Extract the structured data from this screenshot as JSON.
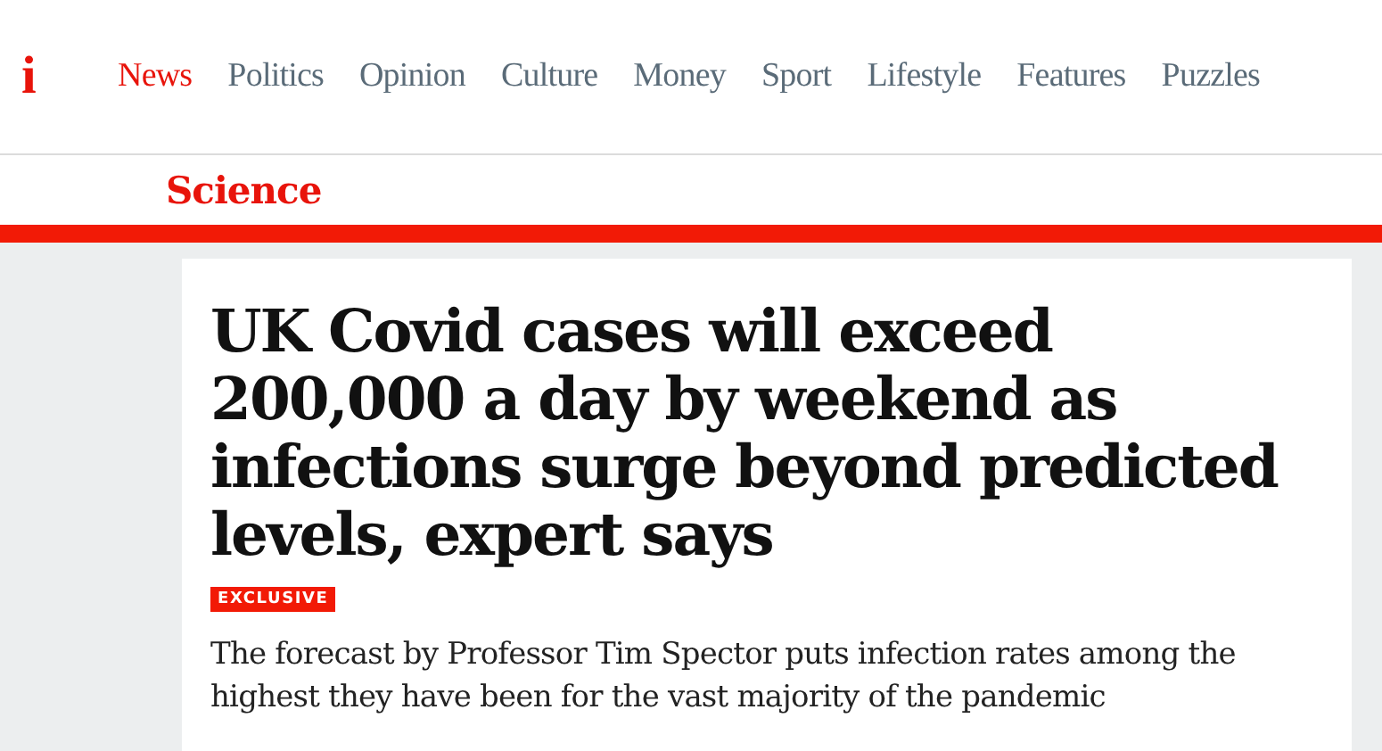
{
  "logo": "i",
  "nav": [
    {
      "label": "News",
      "selected": true
    },
    {
      "label": "Politics",
      "selected": false
    },
    {
      "label": "Opinion",
      "selected": false
    },
    {
      "label": "Culture",
      "selected": false
    },
    {
      "label": "Money",
      "selected": false
    },
    {
      "label": "Sport",
      "selected": false
    },
    {
      "label": "Lifestyle",
      "selected": false
    },
    {
      "label": "Features",
      "selected": false
    },
    {
      "label": "Puzzles",
      "selected": false
    }
  ],
  "section": "Science",
  "article": {
    "headline": "UK Covid cases will exceed 200,000 a day by weekend as infections surge beyond predicted levels, expert says",
    "badge": "EXCLUSIVE",
    "standfirst": "The forecast by Professor Tim Spector puts infection rates among the highest they have been for the vast majority of the pandemic"
  }
}
